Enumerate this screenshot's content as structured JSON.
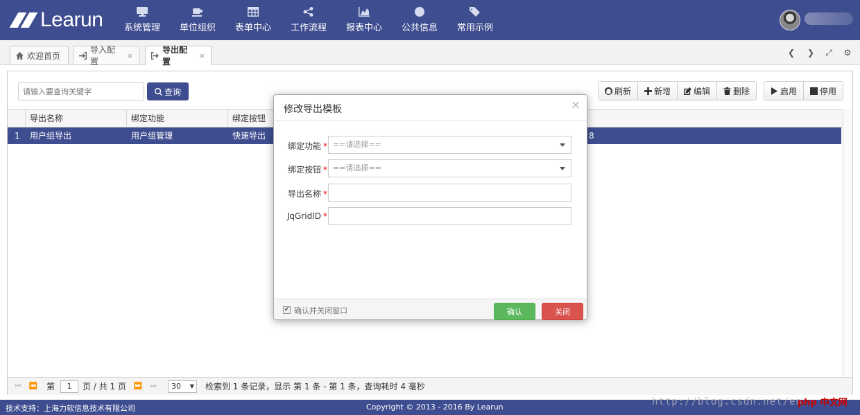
{
  "header": {
    "logo_text": "Learun",
    "nav": [
      {
        "label": "系统管理",
        "icon": "monitor-icon"
      },
      {
        "label": "单位组织",
        "icon": "coffee-icon"
      },
      {
        "label": "表单中心",
        "icon": "table-icon"
      },
      {
        "label": "工作流程",
        "icon": "share-icon"
      },
      {
        "label": "报表中心",
        "icon": "area-chart-icon"
      },
      {
        "label": "公共信息",
        "icon": "globe-icon"
      },
      {
        "label": "常用示例",
        "icon": "tags-icon"
      }
    ]
  },
  "tabs": [
    {
      "label": "欢迎首页",
      "icon": "home-icon"
    },
    {
      "label": "导入配置",
      "icon": "sign-in-icon",
      "close": "×"
    },
    {
      "label": "导出配置",
      "icon": "sign-out-icon",
      "close": "×"
    }
  ],
  "search": {
    "placeholder": "请输入要查询关键字",
    "button": "查询"
  },
  "toolbar": {
    "refresh": "刷新",
    "add": "新增",
    "edit": "编辑",
    "delete": "删除",
    "enable": "启用",
    "disable": "停用"
  },
  "grid": {
    "columns": [
      "导出名称",
      "绑定功能",
      "绑定按钮"
    ],
    "rows": [
      {
        "index": "1",
        "name": "用户组导出",
        "function": "用户组管理",
        "button": "快速导出",
        "tail": "8"
      }
    ]
  },
  "pager": {
    "page_prefix": "第",
    "page": "1",
    "page_suffix": "页 / 共 1 页",
    "page_size": "30",
    "summary": "检索到 1 条记录，显示 第 1 条 - 第 1 条，查询耗时 4 毫秒"
  },
  "footer": {
    "support": "技术支持：上海力软信息技术有限公司",
    "copyright": "Copyright © 2013 - 2016 By Learun"
  },
  "watermark": {
    "url": "http://blog.csdn.net/en",
    "logo_php": "php",
    "logo_cn": "中文网"
  },
  "modal": {
    "title": "修改导出模板",
    "close": "×",
    "fields": [
      {
        "label": "绑定功能",
        "required": "*",
        "placeholder": "==请选择=="
      },
      {
        "label": "绑定按钮",
        "required": "*",
        "placeholder": "==请选择=="
      },
      {
        "label": "导出名称",
        "required": "*",
        "value": ""
      },
      {
        "label": "JqGridID",
        "required": "*",
        "value": ""
      }
    ],
    "checkbox_label": "确认并关闭窗口",
    "ok": "确认",
    "cancel": "关闭"
  },
  "colors": {
    "primary": "#3e4d8f",
    "success": "#5cb85c",
    "danger": "#d9534f"
  }
}
